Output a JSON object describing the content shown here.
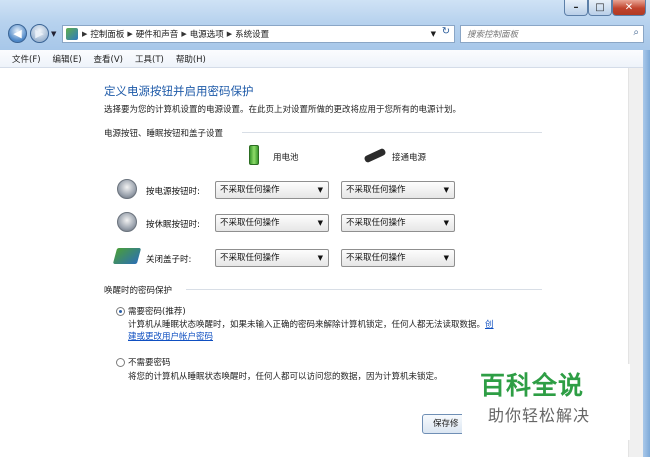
{
  "address_bar": {
    "crumbs": [
      "控制面板",
      "硬件和声音",
      "电源选项",
      "系统设置"
    ]
  },
  "search": {
    "placeholder": "搜索控制面板"
  },
  "menu": [
    "文件(F)",
    "编辑(E)",
    "查看(V)",
    "工具(T)",
    "帮助(H)"
  ],
  "page": {
    "title": "定义电源按钮并启用密码保护",
    "subtitle": "选择要为您的计算机设置的电源设置。在此页上对设置所做的更改将应用于您所有的电源计划。"
  },
  "section_buttons": {
    "header": "电源按钮、睡眠按钮和盖子设置",
    "col_battery": "用电池",
    "col_plugged": "接通电源",
    "rows": [
      {
        "label": "按电源按钮时:",
        "battery": "不采取任何操作",
        "plugged": "不采取任何操作",
        "icon": "power-icon"
      },
      {
        "label": "按休眠按钮时:",
        "battery": "不采取任何操作",
        "plugged": "不采取任何操作",
        "icon": "sleep-icon"
      },
      {
        "label": "关闭盖子时:",
        "battery": "不采取任何操作",
        "plugged": "不采取任何操作",
        "icon": "laptop-lid-icon"
      }
    ]
  },
  "section_password": {
    "header": "唤醒时的密码保护",
    "option1_label": "需要密码(推荐)",
    "option1_desc": "计算机从睡眠状态唤醒时，如果未输入正确的密码来解除计算机锁定，任何人都无法读取数据。",
    "option1_link_a": "创",
    "option1_link_b": "建或更改用户帐户密码",
    "option1_selected": true,
    "option2_label": "不需要密码",
    "option2_desc": "将您的计算机从睡眠状态唤醒时，任何人都可以访问您的数据，因为计算机未锁定。",
    "option2_selected": false
  },
  "footer": {
    "save_label": "保存修"
  },
  "watermark": {
    "line1": "百科全说",
    "line2": "助你轻松解决"
  },
  "colors": {
    "title_blue": "#1e5aa8",
    "link_blue": "#0f4fc1",
    "watermark_green": "#2e9e45"
  }
}
